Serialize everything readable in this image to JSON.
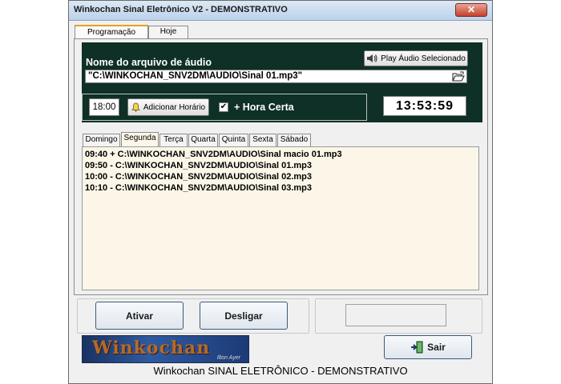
{
  "window": {
    "title": "Winkochan Sinal Eletrônico V2 - DEMONSTRATIVO",
    "close_glyph": "✕"
  },
  "tabs": [
    {
      "label": "Programação",
      "selected": true
    },
    {
      "label": "Hoje",
      "selected": false
    }
  ],
  "audio": {
    "label": "Nome do arquivo de áudio",
    "play_button_label": "Play Áudio Selecionado",
    "play_icon": "speaker-icon",
    "file_path": "\"C:\\WINKOCHAN_SNV2DM\\AUDIO\\Sinal 01.mp3\"",
    "browse_icon": "folder-open-icon"
  },
  "schedule": {
    "time_value": "18:00",
    "add_button_label": "Adicionar Horário",
    "add_icon": "bell-icon",
    "hora_certa_checked": true,
    "hora_certa_label": "+ Hora Certa",
    "clock": "13:53:59"
  },
  "day_tabs": [
    {
      "label": "Domingo",
      "selected": false
    },
    {
      "label": "Segunda",
      "selected": true
    },
    {
      "label": "Terça",
      "selected": false
    },
    {
      "label": "Quarta",
      "selected": false
    },
    {
      "label": "Quinta",
      "selected": false
    },
    {
      "label": "Sexta",
      "selected": false
    },
    {
      "label": "Sábado",
      "selected": false
    }
  ],
  "schedule_list": [
    "09:40 + C:\\WINKOCHAN_SNV2DM\\AUDIO\\Sinal macio 01.mp3",
    "09:50 - C:\\WINKOCHAN_SNV2DM\\AUDIO\\Sinal 01.mp3",
    "10:00 - C:\\WINKOCHAN_SNV2DM\\AUDIO\\Sinal 02.mp3",
    "10:10 - C:\\WINKOCHAN_SNV2DM\\AUDIO\\Sinal 03.mp3"
  ],
  "actions": {
    "activate_label": "Ativar",
    "shutdown_label": "Desligar",
    "exit_label": "Sair",
    "exit_icon": "exit-door-icon",
    "status_field_value": ""
  },
  "logo": {
    "text": "Winkochan",
    "subtitle": "Ilton Ayer"
  },
  "status_bar": {
    "text": "Winkochan SINAL ELETRÔNICO - DEMONSTRATIVO"
  },
  "colors": {
    "panel_bg": "#0e3026",
    "list_bg": "#fbf6e8",
    "tab_accent": "#e8a020",
    "close_red": "#c7402b"
  }
}
